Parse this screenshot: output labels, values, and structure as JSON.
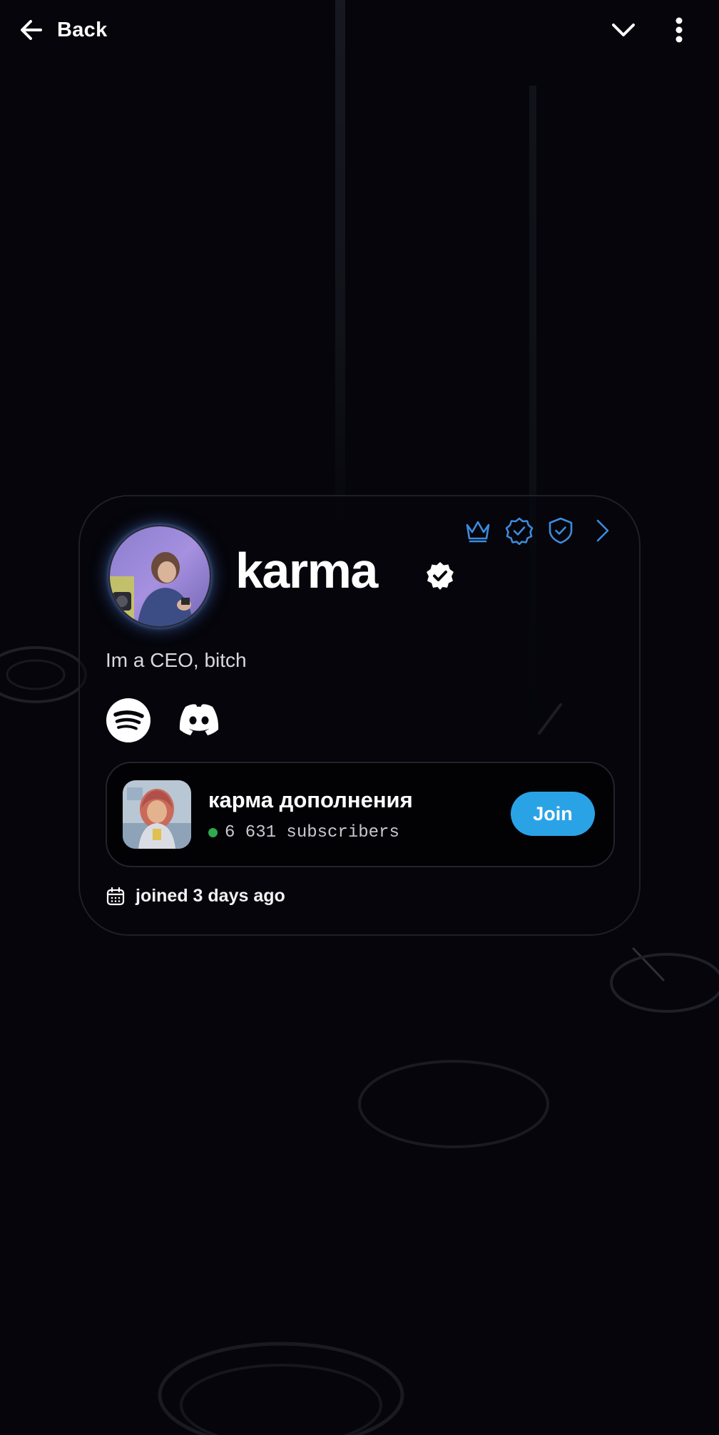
{
  "header": {
    "back_label": "Back",
    "icons": [
      "arrow-left-icon",
      "chevron-down-icon",
      "more-vertical-icon"
    ]
  },
  "profile": {
    "username": "karma",
    "bio": "Im a CEO, bitch",
    "badges": [
      "crown-icon",
      "verified-badge-icon",
      "shield-check-icon",
      "chevron-right-icon"
    ],
    "socials": [
      "spotify-icon",
      "discord-icon"
    ]
  },
  "group": {
    "name": "карма дополнения",
    "subscribers": "6 631 subscribers",
    "join_label": "Join"
  },
  "joined": {
    "text": "joined 3 days ago"
  },
  "colors": {
    "background": "#05050b",
    "accent": "#2aa3e6",
    "badge_blue": "#3d8bdc",
    "online_green": "#2fa84f"
  }
}
